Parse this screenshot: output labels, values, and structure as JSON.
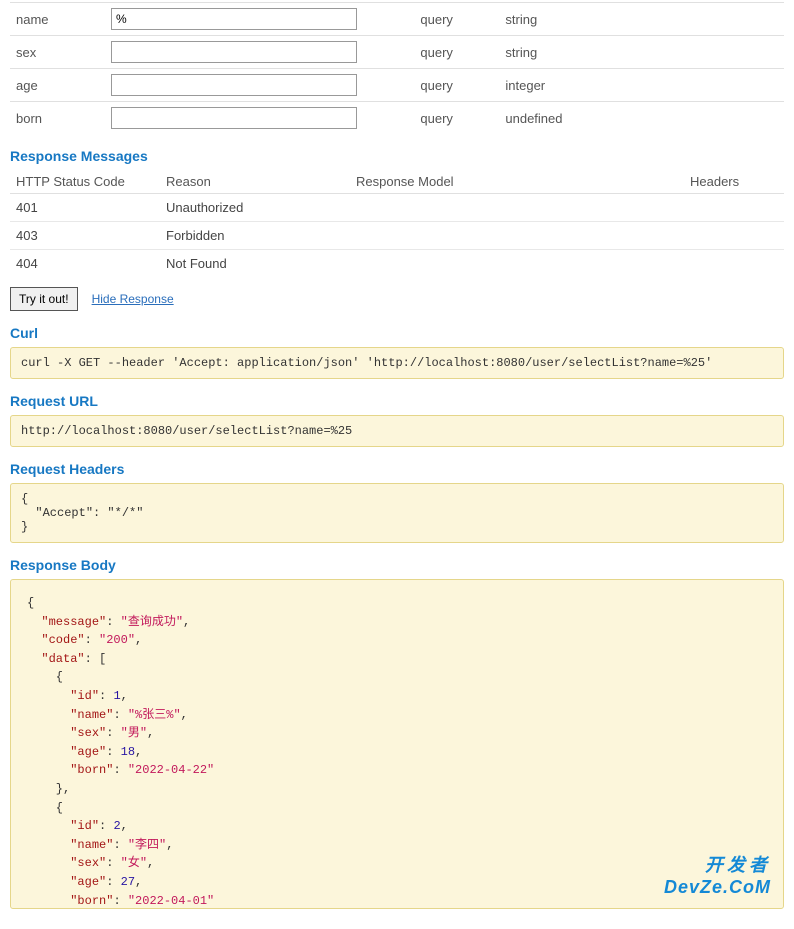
{
  "params": [
    {
      "name": "name",
      "value": "%",
      "paramType": "query",
      "dataType": "string"
    },
    {
      "name": "sex",
      "value": "",
      "paramType": "query",
      "dataType": "string"
    },
    {
      "name": "age",
      "value": "",
      "paramType": "query",
      "dataType": "integer"
    },
    {
      "name": "born",
      "value": "",
      "paramType": "query",
      "dataType": "undefined"
    }
  ],
  "sections": {
    "responseMessages": "Response Messages",
    "curl": "Curl",
    "requestUrl": "Request URL",
    "requestHeaders": "Request Headers",
    "responseBody": "Response Body"
  },
  "respHeaders": {
    "code": "HTTP Status Code",
    "reason": "Reason",
    "model": "Response Model",
    "headers": "Headers"
  },
  "respMessages": [
    {
      "code": "401",
      "reason": "Unauthorized"
    },
    {
      "code": "403",
      "reason": "Forbidden"
    },
    {
      "code": "404",
      "reason": "Not Found"
    }
  ],
  "actions": {
    "tryItOut": "Try it out!",
    "hideResponse": "Hide Response"
  },
  "curl": "curl -X GET --header 'Accept: application/json' 'http://localhost:8080/user/selectList?name=%25'",
  "requestUrl": "http://localhost:8080/user/selectList?name=%25",
  "requestHeaders": "{\n  \"Accept\": \"*/*\"\n}",
  "responseBody": {
    "message": "查询成功",
    "code": "200",
    "data": [
      {
        "id": 1,
        "name": "%张三%",
        "sex": "男",
        "age": 18,
        "born": "2022-04-22"
      },
      {
        "id": 2,
        "name": "李四",
        "sex": "女",
        "age": 27,
        "born": "2022-04-01"
      }
    ]
  },
  "watermark": {
    "cn": "开发者",
    "en": "DevZe.CoM"
  }
}
